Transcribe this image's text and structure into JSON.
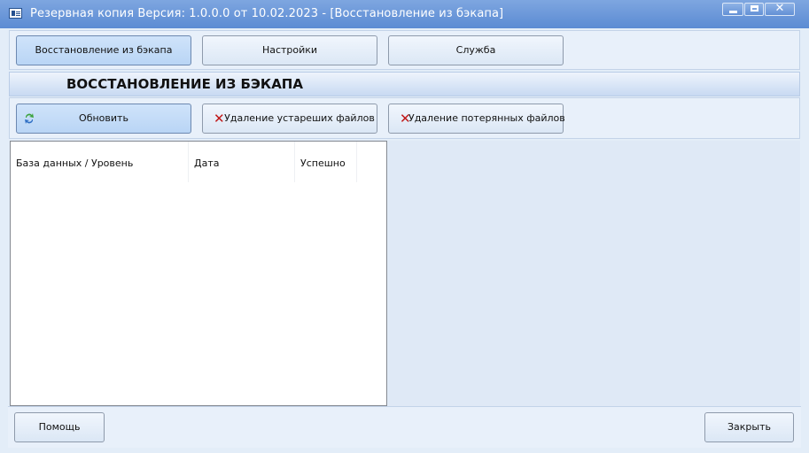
{
  "window": {
    "title": "Резервная копия   Версия: 1.0.0.0 от 10.02.2023 - [Восстановление из бэкапа]",
    "close_glyph": "✕"
  },
  "top_tabs": [
    {
      "label": "Восстановление из бэкапа",
      "active": true
    },
    {
      "label": "Настройки",
      "active": false
    },
    {
      "label": "Служба",
      "active": false
    }
  ],
  "section": {
    "title": "ВОССТАНОВЛЕНИЕ ИЗ БЭКАПА"
  },
  "toolbar": {
    "refresh_label": "Обновить",
    "delete_old_label": "Удаление устареших файлов",
    "delete_lost_label": "Удаление потерянных файлов",
    "delete_icon_glyph": "✕"
  },
  "list": {
    "columns": [
      "База данных / Уровень",
      "Дата",
      "Успешно"
    ]
  },
  "footer": {
    "help_label": "Помощь",
    "close_label": "Закрыть"
  },
  "colors": {
    "titlebar": "#5b8bd3",
    "accent_active": "#b9d5f5",
    "delete_icon": "#c01818",
    "refresh_icon_green": "#3ca23c",
    "refresh_icon_blue": "#2f6fc4"
  },
  "icons": {
    "app": "app-window-icon",
    "refresh": "refresh-icon",
    "delete": "delete-x-icon"
  }
}
